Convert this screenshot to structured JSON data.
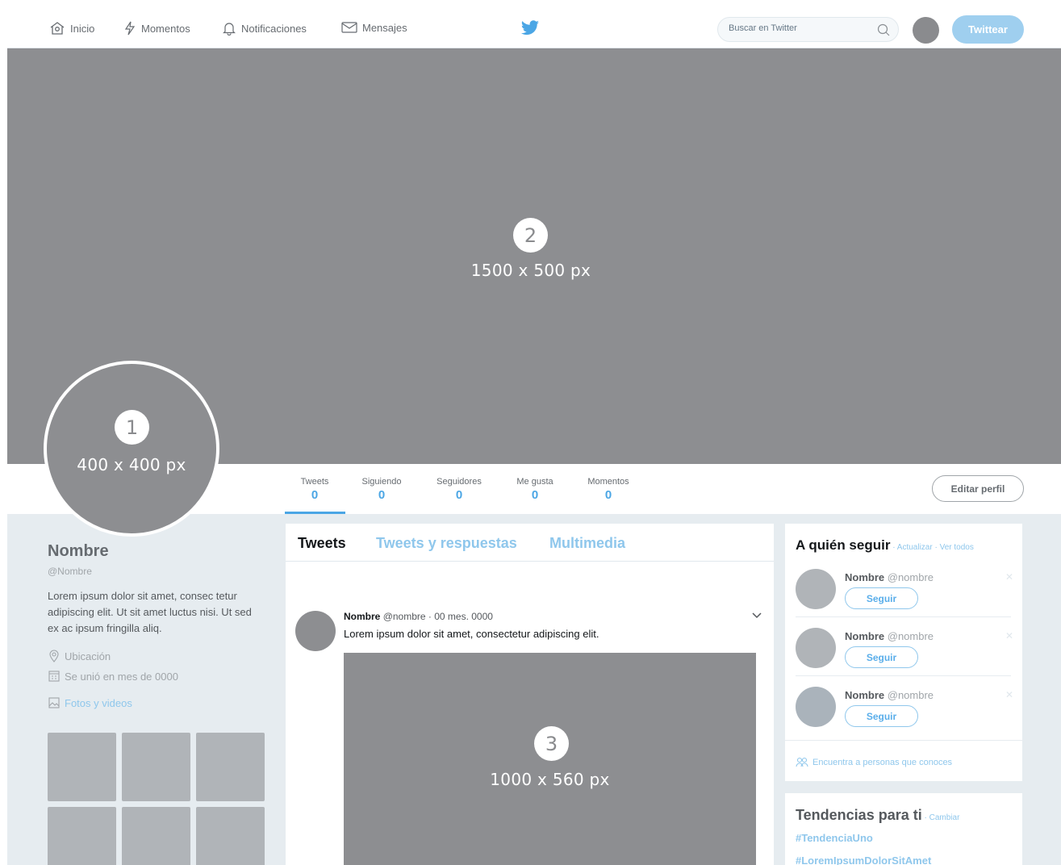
{
  "nav": {
    "items": [
      {
        "label": "Inicio",
        "icon": "home-icon"
      },
      {
        "label": "Momentos",
        "icon": "lightning-icon"
      },
      {
        "label": "Notificaciones",
        "icon": "bell-icon"
      },
      {
        "label": "Mensajes",
        "icon": "envelope-icon"
      }
    ],
    "logo_icon": "twitter-bird-icon",
    "search_placeholder": "Buscar en Twitter",
    "tweet_button": "Twittear"
  },
  "banner": {
    "number": "2",
    "dimensions": "1500 x 500 px"
  },
  "avatar": {
    "number": "1",
    "dimensions": "400 x 400 px"
  },
  "stats": [
    {
      "label": "Tweets",
      "value": "0"
    },
    {
      "label": "Siguiendo",
      "value": "0"
    },
    {
      "label": "Seguidores",
      "value": "0"
    },
    {
      "label": "Me gusta",
      "value": "0"
    },
    {
      "label": "Momentos",
      "value": "0"
    }
  ],
  "edit_profile": "Editar perfil",
  "profile": {
    "name": "Nombre",
    "handle": "@Nombre",
    "bio": "Lorem ipsum dolor sit amet, consec tetur adipiscing elit. Ut sit amet luctus nisi. Ut sed ex ac ipsum fringilla aliq.",
    "location": "Ubicación",
    "joined": "Se unió en mes de 0000",
    "photos_link": "Fotos y videos"
  },
  "timeline": {
    "tabs": [
      "Tweets",
      "Tweets y respuestas",
      "Multimedia"
    ],
    "tweet": {
      "name": "Nombre",
      "meta": "@nombre · 00 mes. 0000",
      "text": "Lorem ipsum dolor sit amet, consectetur adipiscing elit.",
      "media_number": "3",
      "media_dimensions": "1000 x 560 px"
    }
  },
  "who_to_follow": {
    "title": "A quién seguir",
    "refresh": " · Actualizar · Ver todos",
    "suggestions": [
      {
        "name": "Nombre",
        "handle": "@nombre",
        "button": "Seguir"
      },
      {
        "name": "Nombre",
        "handle": "@nombre",
        "button": "Seguir"
      },
      {
        "name": "Nombre",
        "handle": "@nombre",
        "button": "Seguir"
      }
    ],
    "find_people": "Encuentra a personas que conoces"
  },
  "trends": {
    "title": "Tendencias para ti",
    "change": " · Cambiar",
    "items": [
      "#TendenciaUno",
      "#LoremIpsumDolorSitAmet"
    ]
  },
  "colors": {
    "accent": "#4ba6e5",
    "placeholder_gray": "#8d8e91",
    "button_blue": "#9fcfef"
  }
}
